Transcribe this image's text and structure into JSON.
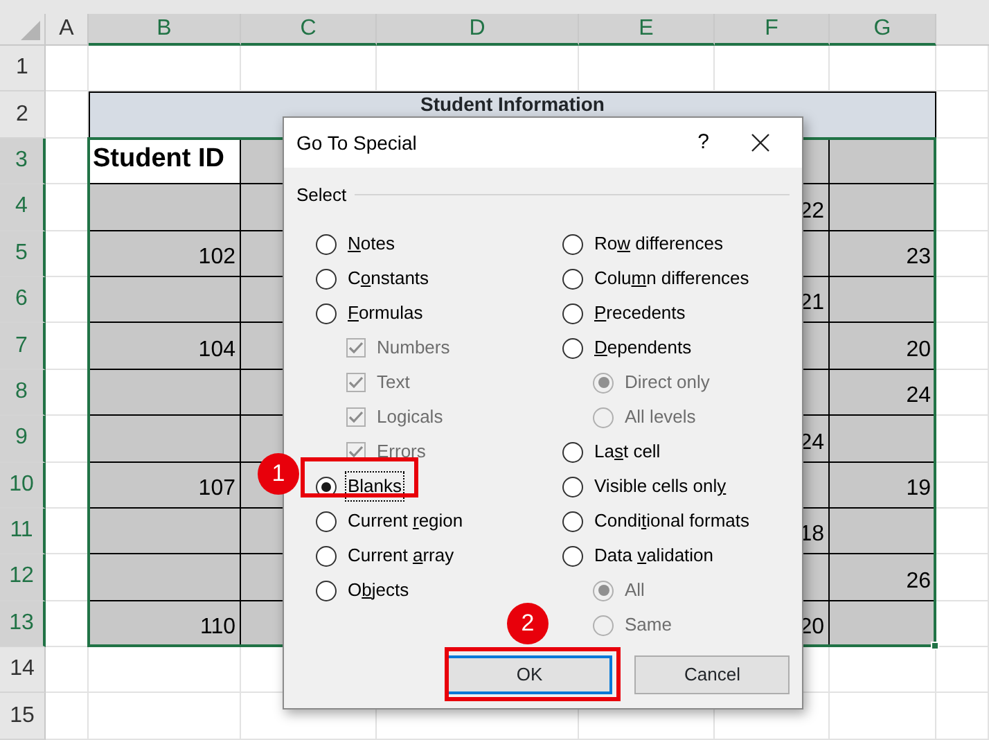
{
  "column_headers": [
    {
      "label": "A",
      "selected": false
    },
    {
      "label": "B",
      "selected": true
    },
    {
      "label": "C",
      "selected": true
    },
    {
      "label": "D",
      "selected": true
    },
    {
      "label": "E",
      "selected": true
    },
    {
      "label": "F",
      "selected": true
    },
    {
      "label": "G",
      "selected": true
    }
  ],
  "row_headers": [
    {
      "label": "1",
      "selected": false
    },
    {
      "label": "2",
      "selected": false
    },
    {
      "label": "3",
      "selected": true
    },
    {
      "label": "4",
      "selected": true
    },
    {
      "label": "5",
      "selected": true
    },
    {
      "label": "6",
      "selected": true
    },
    {
      "label": "7",
      "selected": true
    },
    {
      "label": "8",
      "selected": true
    },
    {
      "label": "9",
      "selected": true
    },
    {
      "label": "10",
      "selected": true
    },
    {
      "label": "11",
      "selected": true
    },
    {
      "label": "12",
      "selected": true
    },
    {
      "label": "13",
      "selected": true
    },
    {
      "label": "14",
      "selected": false
    },
    {
      "label": "15",
      "selected": false
    }
  ],
  "table": {
    "title": "Student Information",
    "heading": "Student ID",
    "rows": [
      {
        "column_f": "22"
      },
      {
        "student_id": "102",
        "column_g": "23"
      },
      {
        "column_f": "21"
      },
      {
        "student_id": "104",
        "column_g": "20"
      },
      {
        "column_g": "24"
      },
      {
        "column_f": "24"
      },
      {
        "student_id": "107",
        "column_g": "19"
      },
      {
        "column_f": "18"
      },
      {
        "column_g": "26"
      },
      {
        "student_id": "110",
        "column_f": "20"
      }
    ]
  },
  "dialog": {
    "title": "Go To Special",
    "help": "?",
    "group_label": "Select",
    "left_options": [
      {
        "label": {
          "key": "N",
          "after": "otes"
        },
        "selected": false
      },
      {
        "label": {
          "before": "C",
          "key": "o",
          "after": "nstants"
        },
        "selected": false
      },
      {
        "label": {
          "key": "F",
          "after": "ormulas"
        },
        "selected": false,
        "children": [
          {
            "kind": "checkbox",
            "label": "Numbers",
            "checked": true,
            "disabled": true
          },
          {
            "kind": "checkbox",
            "label": "Text",
            "checked": true,
            "disabled": true
          },
          {
            "kind": "checkbox",
            "label": "Logicals",
            "checked": true,
            "disabled": true
          },
          {
            "kind": "checkbox",
            "label": "Errors",
            "checked": true,
            "disabled": true
          }
        ]
      },
      {
        "label": {
          "before": "Blan",
          "key": "k",
          "after": "s"
        },
        "selected": true
      },
      {
        "label": {
          "before": "Current ",
          "key": "r",
          "after": "egion"
        },
        "selected": false
      },
      {
        "label": {
          "before": "Current ",
          "key": "a",
          "after": "rray"
        },
        "selected": false
      },
      {
        "label": {
          "before": "O",
          "key": "b",
          "after": "jects"
        },
        "selected": false
      }
    ],
    "right_options": [
      {
        "label": {
          "before": "Ro",
          "key": "w",
          "after": " differences"
        },
        "selected": false
      },
      {
        "label": {
          "before": "Colu",
          "key": "m",
          "after": "n differences"
        },
        "selected": false
      },
      {
        "label": {
          "key": "P",
          "after": "recedents"
        },
        "selected": false
      },
      {
        "label": {
          "key": "D",
          "after": "ependents"
        },
        "selected": false,
        "children": [
          {
            "kind": "radio",
            "label": "Direct only",
            "selected": true,
            "disabled": true
          },
          {
            "kind": "radio",
            "label": "All levels",
            "selected": false,
            "disabled": true
          }
        ]
      },
      {
        "label": {
          "before": "La",
          "key": "s",
          "after": "t cell"
        },
        "selected": false
      },
      {
        "label": {
          "before": "Visible cells onl",
          "key": "y"
        },
        "selected": false
      },
      {
        "label": {
          "before": "Condi",
          "key": "t",
          "after": "ional formats"
        },
        "selected": false
      },
      {
        "label": {
          "before": "Data ",
          "key": "v",
          "after": "alidation"
        },
        "selected": false,
        "children": [
          {
            "kind": "radio",
            "label": "All",
            "selected": true,
            "disabled": true
          },
          {
            "kind": "radio",
            "label": "Same",
            "selected": false,
            "disabled": true
          }
        ]
      }
    ],
    "buttons": [
      {
        "label": "OK",
        "focused": true
      },
      {
        "label": "Cancel",
        "focused": false
      }
    ]
  },
  "callouts": [
    {
      "number": "1"
    },
    {
      "number": "2"
    }
  ]
}
